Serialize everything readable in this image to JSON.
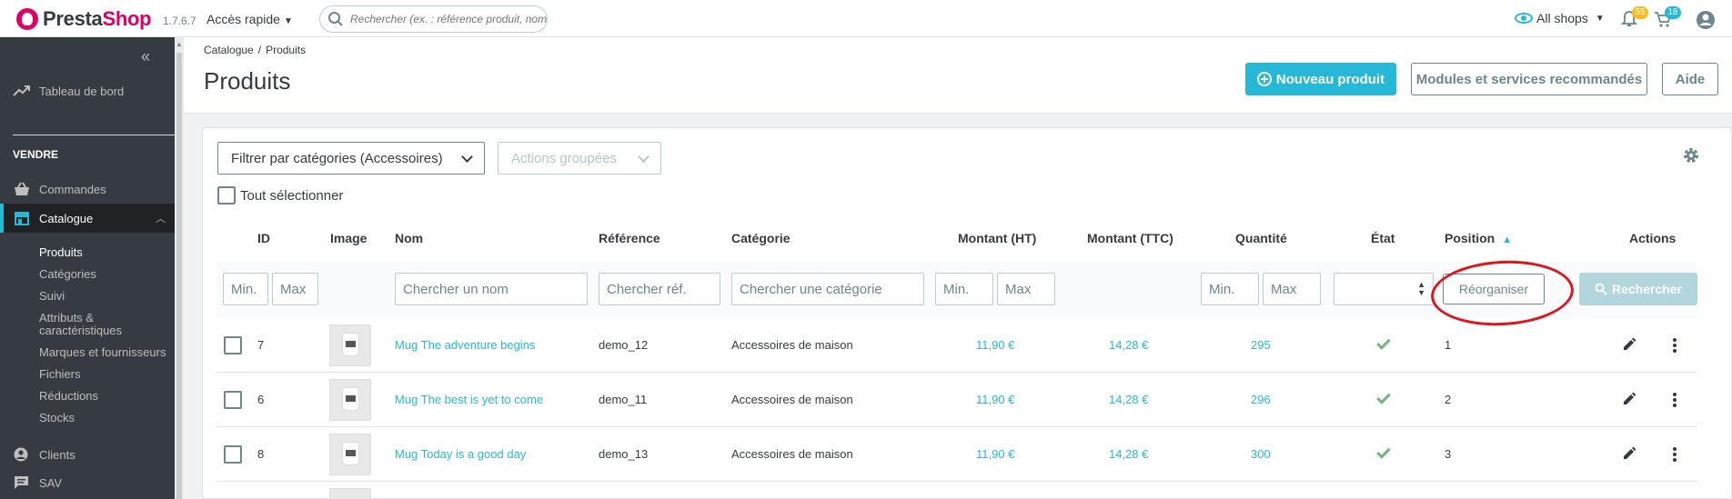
{
  "header": {
    "logo_text_presta": "Presta",
    "logo_text_shop": "Shop",
    "version": "1.7.6.7",
    "quick_access": "Accès rapide",
    "search_placeholder": "Rechercher (ex. : référence produit, nom",
    "shop_selector": "All shops",
    "notif_orders_count": "55",
    "notif_customers_count": "18"
  },
  "sidebar": {
    "dashboard": "Tableau de bord",
    "section_sell": "VENDRE",
    "orders": "Commandes",
    "catalog": "Catalogue",
    "catalog_sub": [
      "Produits",
      "Catégories",
      "Suivi",
      "Attributs & caractéristiques",
      "Marques et fournisseurs",
      "Fichiers",
      "Réductions",
      "Stocks"
    ],
    "customers": "Clients",
    "support": "SAV"
  },
  "page": {
    "breadcrumb_1": "Catalogue",
    "breadcrumb_sep": "/",
    "breadcrumb_2": "Produits",
    "title": "Produits",
    "btn_new": "Nouveau produit",
    "btn_modules": "Modules et services recommandés",
    "btn_help": "Aide"
  },
  "toolbar": {
    "filter_category": "Filtrer par catégories (Accessoires)",
    "bulk_actions": "Actions groupées",
    "select_all": "Tout sélectionner"
  },
  "table": {
    "headers": {
      "id": "ID",
      "image": "Image",
      "name": "Nom",
      "reference": "Référence",
      "category": "Catégorie",
      "price_ht": "Montant (HT)",
      "price_ttc": "Montant (TTC)",
      "quantity": "Quantité",
      "status": "État",
      "position": "Position",
      "actions": "Actions"
    },
    "filters": {
      "id_min": "Min.",
      "id_max": "Max",
      "name": "Chercher un nom",
      "reference": "Chercher réf.",
      "category": "Chercher une catégorie",
      "price_min": "Min.",
      "price_max": "Max",
      "qty_min": "Min.",
      "qty_max": "Max",
      "reorganize": "Réorganiser",
      "search": "Rechercher"
    },
    "rows": [
      {
        "id": "7",
        "name": "Mug The adventure begins",
        "reference": "demo_12",
        "category": "Accessoires de maison",
        "price_ht": "11,90 €",
        "price_ttc": "14,28 €",
        "quantity": "295",
        "position": "1"
      },
      {
        "id": "6",
        "name": "Mug The best is yet to come",
        "reference": "demo_11",
        "category": "Accessoires de maison",
        "price_ht": "11,90 €",
        "price_ttc": "14,28 €",
        "quantity": "296",
        "position": "2"
      },
      {
        "id": "8",
        "name": "Mug Today is a good day",
        "reference": "demo_13",
        "category": "Accessoires de maison",
        "price_ht": "11,90 €",
        "price_ttc": "14,28 €",
        "quantity": "300",
        "position": "3"
      }
    ]
  },
  "colors": {
    "accent": "#25b9d7",
    "sidebar": "#363a41",
    "brand": "#df0067",
    "success": "#70b580",
    "annotation": "#e0141e"
  }
}
